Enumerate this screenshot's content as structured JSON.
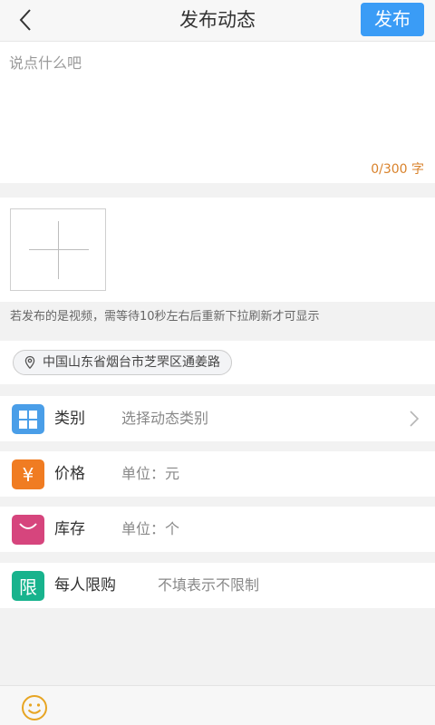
{
  "header": {
    "title": "发布动态",
    "publish_label": "发布",
    "back_icon": "chevron-left-icon"
  },
  "composer": {
    "placeholder": "说点什么吧",
    "value": "",
    "char_count": "0/300 字"
  },
  "media": {
    "add_icon": "plus-icon",
    "video_hint": "若发布的是视频，需等待10秒左右后重新下拉刷新才可显示"
  },
  "location": {
    "icon": "location-pin-icon",
    "text": "中国山东省烟台市芝罘区通姜路"
  },
  "form": {
    "rows": [
      {
        "icon": "grid-icon",
        "color": "#4a9ee8",
        "label": "类别",
        "value": "选择动态类别",
        "has_chevron": true
      },
      {
        "icon": "yen-icon",
        "color": "#f07c22",
        "label": "价格",
        "value": "单位：元",
        "badge_text": "¥"
      },
      {
        "icon": "bag-icon",
        "color": "#d6457d",
        "label": "库存",
        "value": "单位：个"
      },
      {
        "icon": "limit-icon",
        "color": "#18b38d",
        "label": "每人限购",
        "value": "不填表示不限制",
        "badge_text": "限"
      }
    ]
  },
  "footer": {
    "emoji_icon": "emoji-icon"
  },
  "colors": {
    "accent": "#3a9cf6",
    "counter": "#d9822b"
  }
}
